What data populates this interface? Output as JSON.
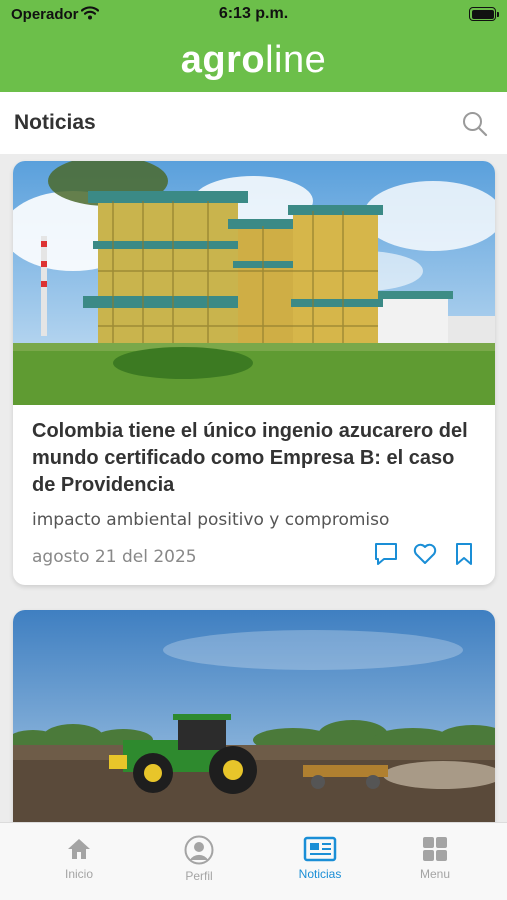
{
  "status_bar": {
    "carrier": "Operador",
    "time": "6:13 p.m."
  },
  "header": {
    "logo_bold": "agro",
    "logo_light": "line"
  },
  "section": {
    "title": "Noticias"
  },
  "articles": [
    {
      "title": "Colombia tiene el único ingenio azucarero del mundo certificado como Empresa B: el caso de Providencia",
      "subtitle": "impacto ambiental positivo y compromiso",
      "date": "agosto 21 del 2025"
    }
  ],
  "tabs": [
    {
      "label": "Inicio",
      "icon": "home-icon",
      "active": false
    },
    {
      "label": "Perfil",
      "icon": "profile-icon",
      "active": false
    },
    {
      "label": "Noticias",
      "icon": "newspaper-icon",
      "active": true
    },
    {
      "label": "Menu",
      "icon": "grid-icon",
      "active": false
    }
  ],
  "colors": {
    "brand_green": "#6cbf4a",
    "accent_blue": "#1a8ed6",
    "inactive_gray": "#a4a4a4"
  }
}
